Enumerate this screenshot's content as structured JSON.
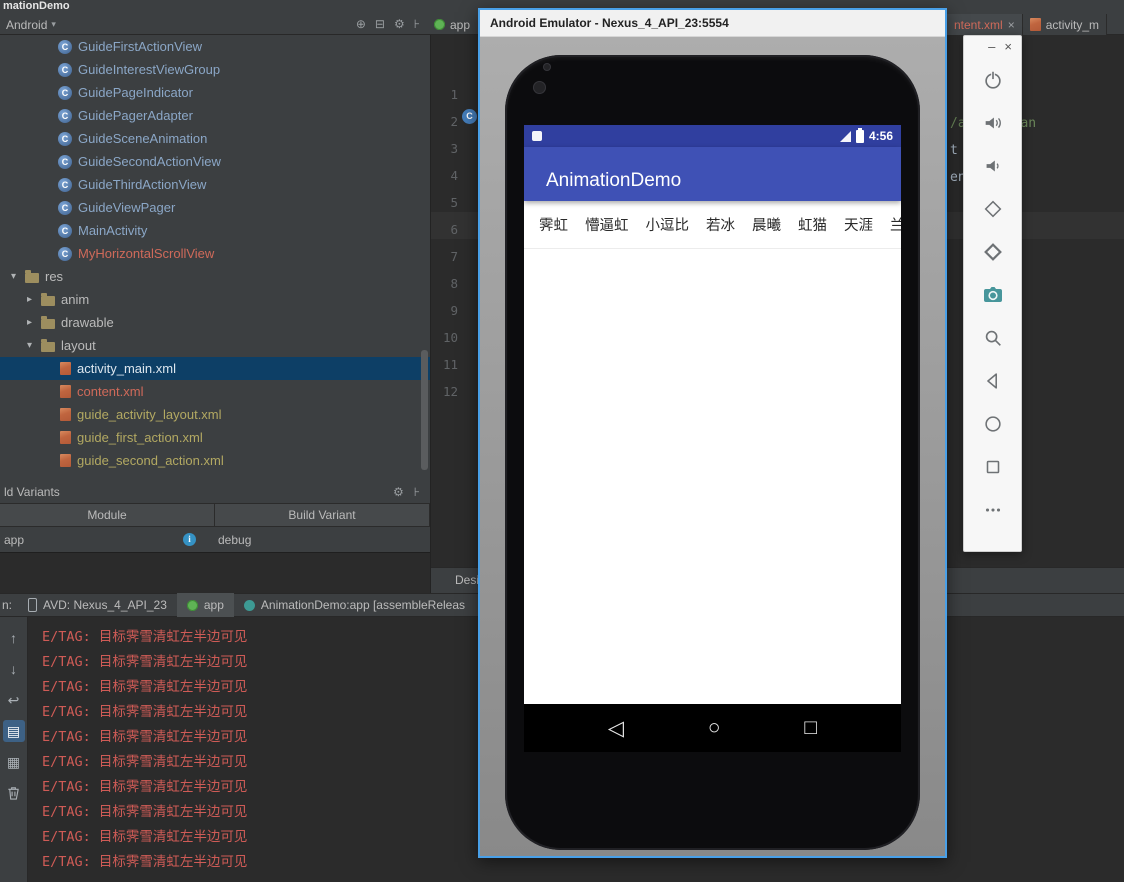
{
  "colors": {
    "accent_blue": "#3f51b5",
    "status_bar_blue": "#303f9f",
    "tree_selection_blue": "#0d3f66",
    "log_error_red": "#cf5b56",
    "class_name_blue": "#8ba7c7",
    "new_file_red": "#cf6a5a",
    "xml_file_amber": "#b3a962",
    "emulator_border_blue": "#49a0e8",
    "camera_teal": "#47969b"
  },
  "titlebar": {
    "title": "mationDemo"
  },
  "toolbar": {
    "view_selector": "Android",
    "selector_arrow": "▾",
    "icons": [
      "⊕",
      "⊟",
      "⚙",
      "⊦"
    ],
    "crumb_app": "app"
  },
  "editor_tabs": [
    {
      "label": "ntent.xml",
      "close": "×"
    },
    {
      "label": "activity_m"
    }
  ],
  "project": {
    "expand_icon": "▾",
    "collapse_icon": "▸",
    "class_letter": "C",
    "classes": [
      {
        "name": "GuideFirstActionView"
      },
      {
        "name": "GuideInterestViewGroup"
      },
      {
        "name": "GuidePageIndicator"
      },
      {
        "name": "GuidePagerAdapter"
      },
      {
        "name": "GuideSceneAnimation"
      },
      {
        "name": "GuideSecondActionView"
      },
      {
        "name": "GuideThirdActionView"
      },
      {
        "name": "GuideViewPager"
      },
      {
        "name": "MainActivity"
      },
      {
        "name": "MyHorizontalScrollView"
      }
    ],
    "folders": {
      "res": "res",
      "anim": "anim",
      "drawable": "drawable",
      "layout": "layout"
    },
    "layout_files": [
      {
        "name": "activity_main.xml",
        "selected": true
      },
      {
        "name": "content.xml"
      },
      {
        "name": "guide_activity_layout.xml"
      },
      {
        "name": "guide_first_action.xml"
      },
      {
        "name": "guide_second_action.xml"
      }
    ]
  },
  "build_variants": {
    "title": "ld Variants",
    "icons": [
      "⚙",
      "⊦"
    ],
    "module_col": "Module",
    "variant_col": "Build Variant",
    "row": {
      "module": "app",
      "info": "i",
      "variant": "debug"
    }
  },
  "editor": {
    "line_numbers": [
      "1",
      "2",
      "3",
      "4",
      "5",
      "6",
      "7",
      "8",
      "9",
      "10",
      "11",
      "12"
    ],
    "gutter_class_letter": "C",
    "fragments": [
      "/apk/res/an",
      "t",
      "ent"
    ],
    "design_tab": "Desig"
  },
  "run_panel": {
    "prefix": "n:",
    "tabs": [
      {
        "label": "AVD: Nexus_4_API_23"
      },
      {
        "label": "app"
      },
      {
        "label": "AnimationDemo:app [assembleReleas"
      }
    ],
    "strip_icons": {
      "up": "↑",
      "down": "↓",
      "wrap": "↩",
      "print": "▤",
      "stack": "▦"
    },
    "logs": [
      "E/TAG: 目标霁雪清虹左半边可见",
      "E/TAG: 目标霁雪清虹左半边可见",
      "E/TAG: 目标霁雪清虹左半边可见",
      "E/TAG: 目标霁雪清虹左半边可见",
      "E/TAG: 目标霁雪清虹左半边可见",
      "E/TAG: 目标霁雪清虹左半边可见",
      "E/TAG: 目标霁雪清虹左半边可见",
      "E/TAG: 目标霁雪清虹左半边可见",
      "E/TAG: 目标霁雪清虹左半边可见",
      "E/TAG: 目标霁雪清虹左半边可见"
    ]
  },
  "emulator": {
    "window_title": "Android Emulator - Nexus_4_API_23:5554",
    "minimize": "–",
    "close": "×",
    "app_title": "AnimationDemo",
    "status_time": "4:56",
    "list_items": [
      "霁虹",
      "懵逼虹",
      "小逗比",
      "若冰",
      "晨曦",
      "虹猫",
      "天涯",
      "兰亭书序"
    ],
    "nav": {
      "back": "◁",
      "home": "○",
      "recents": "□"
    }
  }
}
